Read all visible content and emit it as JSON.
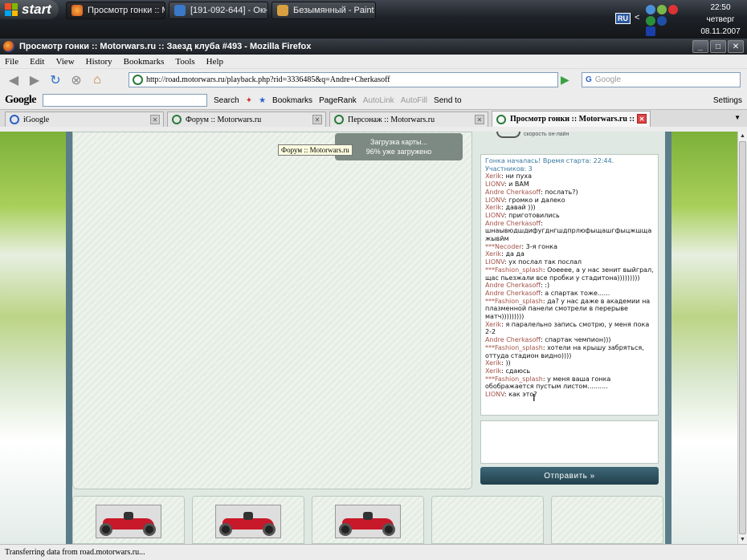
{
  "taskbar": {
    "start_label": "start",
    "tasks": [
      {
        "label": "Просмотр гонки :: М...",
        "active": true
      },
      {
        "label": "[191-092-644] - Окн...",
        "active": false
      },
      {
        "label": "Безымянный - Paint",
        "active": false
      }
    ],
    "tray": {
      "lang": "RU",
      "arrow": "<",
      "icons": [
        "network-icon",
        "volume-icon",
        "messenger-icon",
        "antivirus-icon",
        "media-icon",
        "update-icon"
      ]
    },
    "clock": {
      "time": "22:50",
      "day": "четверг",
      "date": "08.11.2007"
    }
  },
  "window": {
    "title": "Просмотр гонки :: Motorwars.ru :: Заезд клуба #493 - Mozilla Firefox",
    "buttons": [
      "_",
      "□",
      "✕"
    ]
  },
  "menu": [
    "File",
    "Edit",
    "View",
    "History",
    "Bookmarks",
    "Tools",
    "Help"
  ],
  "nav": {
    "url": "http://road.motorwars.ru/playback.php?rid=3336485&q=Andre+Cherkasoff",
    "search_placeholder": "Google"
  },
  "google_toolbar": {
    "logo": "Google",
    "search_label": "Search",
    "bookmarks_label": "Bookmarks",
    "pagerank_label": "PageRank",
    "autolink_label": "AutoLink",
    "autofill_label": "AutoFill",
    "sendto_label": "Send to",
    "settings_label": "Settings"
  },
  "tabs": [
    {
      "label": "iGoogle",
      "active": false
    },
    {
      "label": "Форум :: Motorwars.ru",
      "active": false
    },
    {
      "label": "Персонаж :: Motorwars.ru",
      "active": false
    },
    {
      "label": "Просмотр гонки :: Motorwars.ru :: ...",
      "active": true
    }
  ],
  "game": {
    "loading_line1": "Загрузка карты...",
    "loading_line2": "96% уже загружено",
    "tooltip": "Форум :: Motorwars.ru",
    "speed_label": "скорость он-лайн"
  },
  "chat": {
    "messages": [
      {
        "sys": "Гонка началась! Время старта: 22:44."
      },
      {
        "sys": "Участников: 3"
      },
      {
        "name": "Xerik",
        "text": "ни пуха"
      },
      {
        "name": "LIONV",
        "text": "и ВАМ"
      },
      {
        "name": "Andre Cherkasoff",
        "text": "послать?)"
      },
      {
        "name": "LIONV",
        "text": "громко и далеко"
      },
      {
        "name": "Xerik",
        "text": "давай )))"
      },
      {
        "name": "LIONV",
        "text": "приготовились"
      },
      {
        "name": "Andre Cherkasoff",
        "text": "шнаывюдшдифугднгшдпрлюфыщашгфыцжшща жывйм"
      },
      {
        "name": "***Necoder",
        "text": "3-я гонка"
      },
      {
        "name": "Xerik",
        "text": "да да"
      },
      {
        "name": "LIONV",
        "text": "ух послал так послал"
      },
      {
        "name": "***Fashion_splash",
        "text": "Ооееее, а у нас зенит выйграл, щас пьезжали все пробки у стадитона)))))))))"
      },
      {
        "name": "Andre Cherkasoff",
        "text": ":)"
      },
      {
        "name": "Andre Cherkasoff",
        "text": "а спартак тоже......"
      },
      {
        "name": "***Fashion_splash",
        "text": "да? у нас даже в академии на плазменной панели смотрели в перерыве матч)))))))))"
      },
      {
        "name": "Xerik",
        "text": "я паралельно запись смотрю, у меня пока 2-2"
      },
      {
        "name": "Andre Cherkasoff",
        "text": "спартак чемпион)))"
      },
      {
        "name": "***Fashion_splash",
        "text": "хотели на крышу забряться, оттуда стадион видно))))"
      },
      {
        "name": "Xerik",
        "text": "))"
      },
      {
        "name": "Xerik",
        "text": "сдаюсь"
      },
      {
        "name": "***Fashion_splash",
        "text": "у меня ваша гонка обображается пустым листом.........."
      },
      {
        "name": "LIONV",
        "text": "как это?"
      }
    ],
    "send_label": "Отправить »"
  },
  "status": "Transferring data from road.motorwars.ru..."
}
